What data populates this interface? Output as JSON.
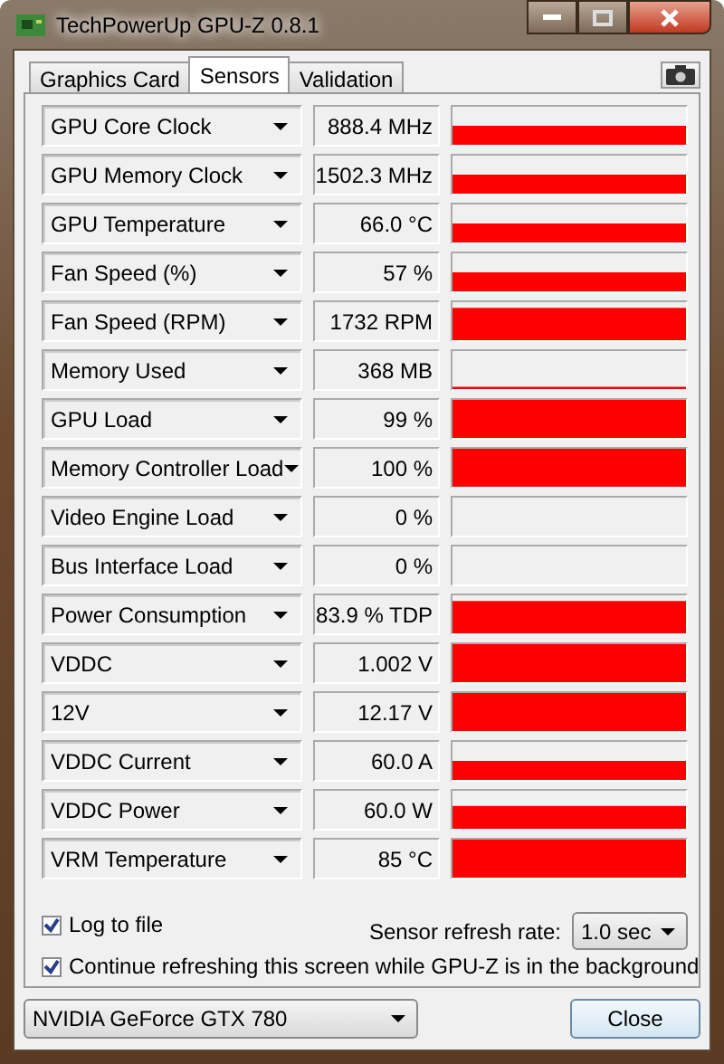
{
  "window": {
    "title": "TechPowerUp GPU-Z 0.8.1"
  },
  "tabs": [
    {
      "label": "Graphics Card",
      "selected": false
    },
    {
      "label": "Sensors",
      "selected": true
    },
    {
      "label": "Validation",
      "selected": false
    }
  ],
  "sensors": [
    {
      "name": "GPU Core Clock",
      "reading": "888.4 MHz"
    },
    {
      "name": "GPU Memory Clock",
      "reading": "1502.3 MHz"
    },
    {
      "name": "GPU Temperature",
      "reading": "66.0 °C"
    },
    {
      "name": "Fan Speed (%)",
      "reading": "57 %"
    },
    {
      "name": "Fan Speed (RPM)",
      "reading": "1732 RPM"
    },
    {
      "name": "Memory Used",
      "reading": "368 MB"
    },
    {
      "name": "GPU Load",
      "reading": "99 %"
    },
    {
      "name": "Memory Controller Load",
      "reading": "100 %"
    },
    {
      "name": "Video Engine Load",
      "reading": "0 %"
    },
    {
      "name": "Bus Interface Load",
      "reading": "0 %"
    },
    {
      "name": "Power Consumption",
      "reading": "83.9 % TDP"
    },
    {
      "name": "VDDC",
      "reading": "1.002 V"
    },
    {
      "name": "12V",
      "reading": "12.17 V"
    },
    {
      "name": "VDDC Current",
      "reading": "60.0 A"
    },
    {
      "name": "VDDC Power",
      "reading": "60.0 W"
    },
    {
      "name": "VRM Temperature",
      "reading": "85 °C"
    }
  ],
  "options": [
    {
      "label": "Log to file",
      "checked": true
    },
    {
      "label": "Continue refreshing this screen while GPU-Z is in the background",
      "checked": true
    }
  ],
  "refresh": {
    "label": "Sensor refresh rate:",
    "value": "1.0 sec"
  },
  "device": {
    "value": "NVIDIA GeForce GTX 780"
  },
  "buttons": [
    "Close"
  ]
}
